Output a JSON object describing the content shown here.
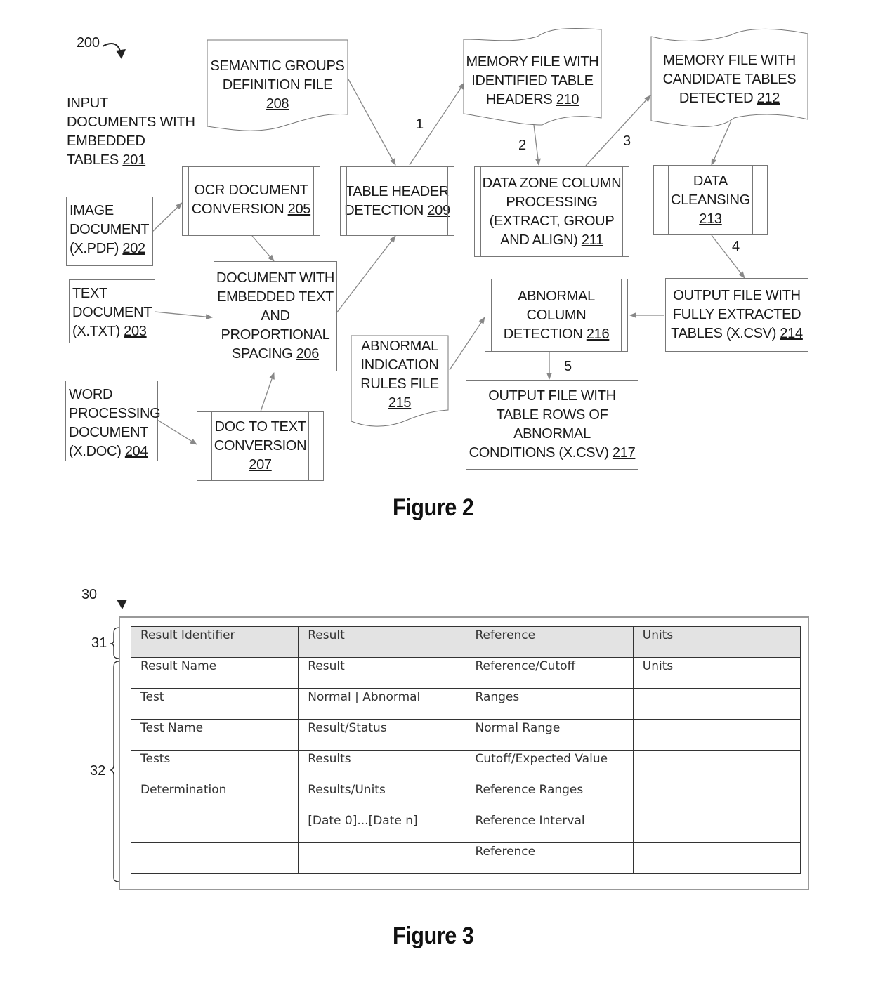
{
  "figure2": {
    "ref_label": "200",
    "caption": "Figure 2",
    "input_label": {
      "lines": [
        "INPUT",
        "DOCUMENTS WITH",
        "EMBEDDED",
        "TABLES"
      ],
      "ref": "201"
    },
    "nodes": {
      "n202": {
        "lines": [
          "IMAGE",
          "DOCUMENT",
          "(X.PDF)"
        ],
        "ref": "202"
      },
      "n203": {
        "lines": [
          "TEXT",
          "DOCUMENT",
          "(X.TXT)"
        ],
        "ref": "203"
      },
      "n204": {
        "lines": [
          "WORD",
          "PROCESSING",
          "DOCUMENT",
          "(X.DOC)"
        ],
        "ref": "204"
      },
      "n205": {
        "lines": [
          "OCR DOCUMENT",
          "CONVERSION"
        ],
        "ref": "205"
      },
      "n206": {
        "lines": [
          "DOCUMENT WITH",
          "EMBEDDED TEXT",
          "AND",
          "PROPORTIONAL",
          "SPACING"
        ],
        "ref": "206"
      },
      "n207": {
        "lines": [
          "DOC TO TEXT",
          "CONVERSION"
        ],
        "ref": "207"
      },
      "n208": {
        "lines": [
          "SEMANTIC GROUPS",
          "DEFINITION FILE"
        ],
        "ref": "208"
      },
      "n209": {
        "lines": [
          "TABLE HEADER",
          "DETECTION"
        ],
        "ref": "209"
      },
      "n210": {
        "lines": [
          "MEMORY FILE WITH",
          "IDENTIFIED TABLE",
          "HEADERS"
        ],
        "ref": "210"
      },
      "n211": {
        "lines": [
          "DATA ZONE COLUMN",
          "PROCESSING",
          "(EXTRACT, GROUP",
          "AND ALIGN)"
        ],
        "ref": "211"
      },
      "n212": {
        "lines": [
          "MEMORY FILE WITH",
          "CANDIDATE TABLES",
          "DETECTED"
        ],
        "ref": "212"
      },
      "n213": {
        "lines": [
          "DATA",
          "CLEANSING"
        ],
        "ref": "213"
      },
      "n214": {
        "lines": [
          "OUTPUT FILE WITH",
          "FULLY EXTRACTED",
          "TABLES (X.CSV)"
        ],
        "ref": "214"
      },
      "n215": {
        "lines": [
          "ABNORMAL",
          "INDICATION",
          "RULES FILE"
        ],
        "ref": "215"
      },
      "n216": {
        "lines": [
          "ABNORMAL",
          "COLUMN",
          "DETECTION"
        ],
        "ref": "216"
      },
      "n217": {
        "lines": [
          "OUTPUT FILE WITH",
          "TABLE ROWS OF",
          "ABNORMAL",
          "CONDITIONS (X.CSV)"
        ],
        "ref": "217"
      }
    },
    "step_labels": [
      "1",
      "2",
      "3",
      "4",
      "5"
    ]
  },
  "figure3": {
    "ref_label": "30",
    "caption": "Figure 3",
    "brace_header_label": "31",
    "brace_body_label": "32",
    "header_row": [
      "Result Identifier",
      "Result",
      "Reference",
      "Units"
    ],
    "rows": [
      [
        "Result Name",
        "Result",
        "Reference/Cutoff",
        "Units"
      ],
      [
        "Test",
        "Normal | Abnormal",
        "Ranges",
        ""
      ],
      [
        "Test Name",
        "Result/Status",
        "Normal Range",
        ""
      ],
      [
        "Tests",
        "Results",
        "Cutoff/Expected Value",
        ""
      ],
      [
        "Determination",
        "Results/Units",
        "Reference Ranges",
        ""
      ],
      [
        "",
        "[Date 0]...[Date n]",
        "Reference Interval",
        ""
      ],
      [
        "",
        "",
        "Reference",
        ""
      ]
    ]
  }
}
